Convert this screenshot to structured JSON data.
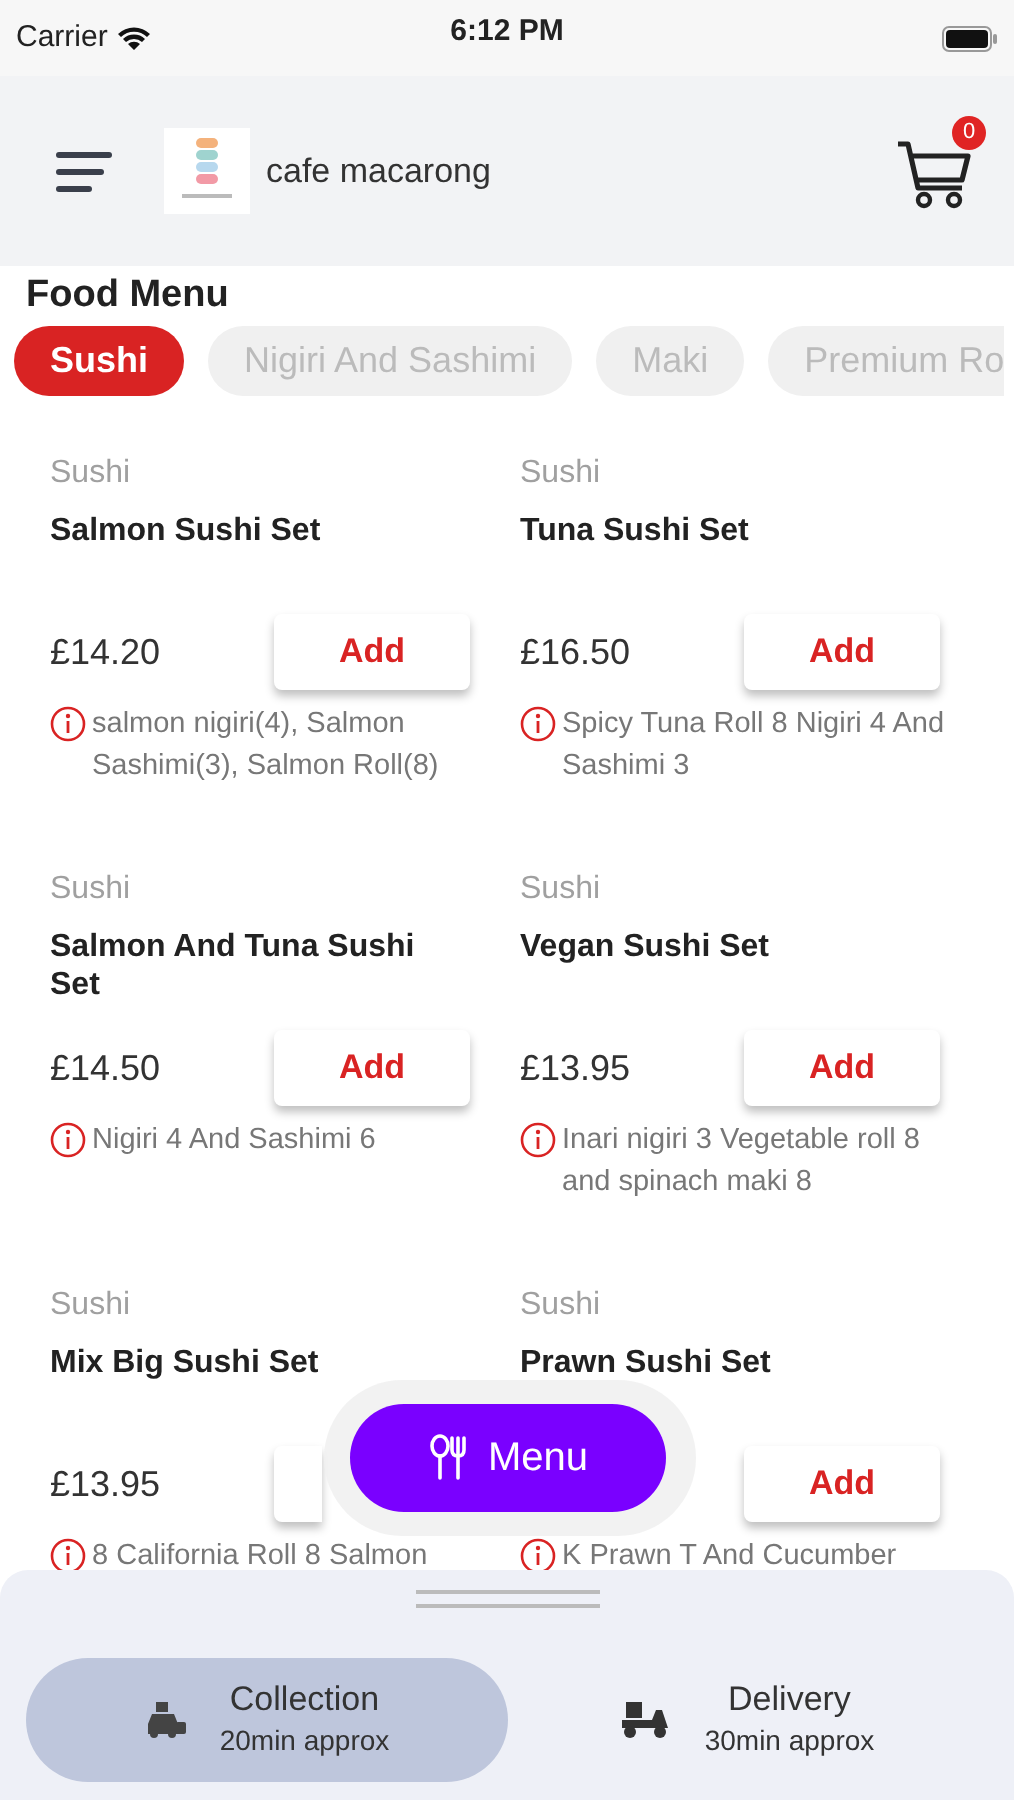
{
  "status_bar": {
    "carrier": "Carrier",
    "time": "6:12 PM"
  },
  "header": {
    "shop_name": "cafe macarong",
    "cart_count": "0"
  },
  "section_title": "Food Menu",
  "categories": [
    {
      "label": "Sushi",
      "selected": true
    },
    {
      "label": "Nigiri And Sashimi",
      "selected": false
    },
    {
      "label": "Maki",
      "selected": false
    },
    {
      "label": "Premium Ro",
      "selected": false
    }
  ],
  "items": [
    {
      "category": "Sushi",
      "name": "Salmon Sushi Set",
      "price": "£14.20",
      "button": "Add",
      "description": "salmon nigiri(4), Salmon Sashimi(3), Salmon Roll(8)"
    },
    {
      "category": "Sushi",
      "name": "Tuna Sushi Set",
      "price": "£16.50",
      "button": "Add",
      "description": "Spicy Tuna Roll 8 Nigiri 4 And Sashimi 3"
    },
    {
      "category": "Sushi",
      "name": "Salmon And Tuna Sushi Set",
      "price": "£14.50",
      "button": "Add",
      "description": "Nigiri 4 And Sashimi 6"
    },
    {
      "category": "Sushi",
      "name": "Vegan Sushi Set",
      "price": "£13.95",
      "button": "Add",
      "description": "Inari nigiri 3 Vegetable roll 8 and spinach maki 8"
    },
    {
      "category": "Sushi",
      "name": "Mix Big Sushi Set",
      "price": "£13.95",
      "description": "8 California Roll 8 Salmon"
    },
    {
      "category": "Sushi",
      "name": "Prawn Sushi Set",
      "button": "Add",
      "description": "K Prawn T And Cucumber"
    }
  ],
  "menu_button": "Menu",
  "order_modes": [
    {
      "kind": "collection",
      "label": "Collection",
      "time": "20min approx",
      "selected": true
    },
    {
      "kind": "delivery",
      "label": "Delivery",
      "time": "30min approx",
      "selected": false
    }
  ]
}
